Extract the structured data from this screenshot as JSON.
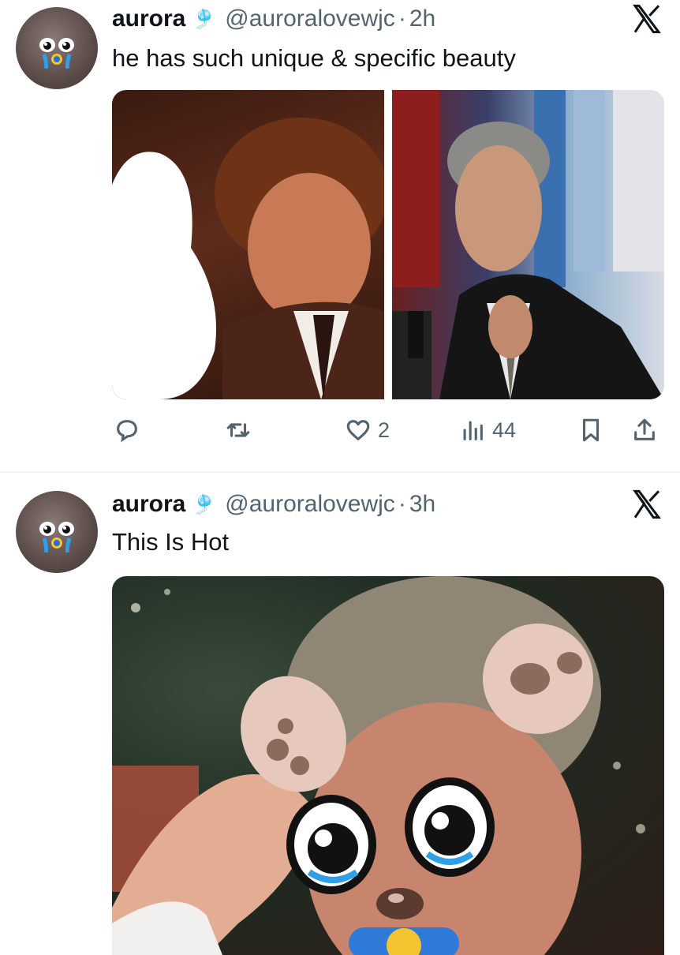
{
  "tweets": [
    {
      "author_name": "aurora",
      "badge": "🎐",
      "handle": "@auroralovewjc",
      "separator": "·",
      "time": "2h",
      "text": "he has such unique & specific beauty",
      "actions": {
        "reply": "",
        "retweet": "",
        "like_count": "2",
        "views_count": "44"
      }
    },
    {
      "author_name": "aurora",
      "badge": "🎐",
      "handle": "@auroralovewjc",
      "separator": "·",
      "time": "3h",
      "text": "This Is Hot"
    }
  ],
  "colors": {
    "text_primary": "#0f1419",
    "text_secondary": "#536471",
    "divider": "#eff3f4"
  },
  "icons": [
    "x-logo-icon",
    "reply-icon",
    "retweet-icon",
    "like-icon",
    "views-icon",
    "bookmark-icon",
    "share-icon"
  ]
}
